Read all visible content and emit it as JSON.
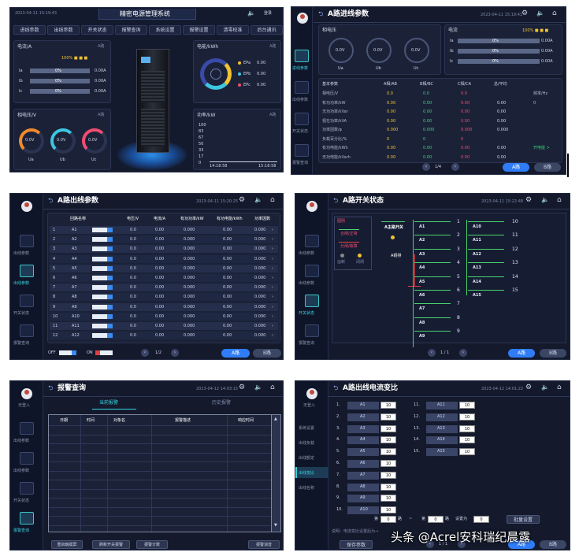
{
  "p1": {
    "time": "2023-04-11 15:19:43",
    "title": "精密电源管理系统",
    "login": "登录",
    "tabs": [
      "进线参数",
      "出线参数",
      "开关状态",
      "报警查询",
      "系统设置",
      "报警设置",
      "清零校准",
      "后台通讯"
    ],
    "current": {
      "title": "电流/A",
      "tag": "A路",
      "legend": "100% ■ ■ ■",
      "rows": [
        {
          "l": "Ia",
          "p": "0%",
          "v": "0.00A"
        },
        {
          "l": "Ib",
          "p": "0%",
          "v": "0.00A"
        },
        {
          "l": "Ic",
          "p": "0%",
          "v": "0.00A"
        }
      ]
    },
    "energy": {
      "title": "电能/kWh",
      "tag": "A路",
      "rows": [
        {
          "l": "EPa",
          "v": "0.00"
        },
        {
          "l": "EPb",
          "v": "0.00"
        },
        {
          "l": "EPc",
          "v": "0.00"
        }
      ]
    },
    "voltage": {
      "title": "相电压/V",
      "tag": "A路",
      "gauges": [
        {
          "v": "0.0V",
          "l": "Ua"
        },
        {
          "v": "0.0V",
          "l": "Ub"
        },
        {
          "v": "0.0V",
          "l": "Uc"
        }
      ]
    },
    "power": {
      "title": "功率/kW",
      "tag": "A路",
      "ticks": [
        "100",
        "83",
        "67",
        "50",
        "33",
        "17",
        "0"
      ],
      "t1": "14:18:58",
      "t2": "15:18:58"
    }
  },
  "p2": {
    "title": "A路进线参数",
    "time": "2023-04-11 15:19:41",
    "nav": [
      "进线参数",
      "出线参数",
      "开关状态",
      "报警查询"
    ],
    "phase_v": {
      "title": "相电压",
      "gauges": [
        {
          "v": "0.0V",
          "l": "Ua"
        },
        {
          "v": "0.0V",
          "l": "Ub"
        },
        {
          "v": "0.0V",
          "l": "Uc"
        }
      ]
    },
    "current": {
      "title": "电流",
      "legend": "100% ■ ■ ■",
      "rows": [
        {
          "l": "Ia",
          "p": "0%",
          "v": "0.00A"
        },
        {
          "l": "Ib",
          "p": "0%",
          "v": "0.00A"
        },
        {
          "l": "Ic",
          "p": "0%",
          "v": "0.00A"
        }
      ]
    },
    "headers": [
      "基本参数",
      "A相/AB",
      "B相/BC",
      "C相/CA",
      "总/平均"
    ],
    "rows": [
      {
        "n": "相电压/V",
        "a": "0.0",
        "b": "0.0",
        "c": "0.0",
        "t": "",
        "x": "频率/Hz"
      },
      {
        "n": "有功功率/kW",
        "a": "0.00",
        "b": "0.00",
        "c": "0.00",
        "t": "0.00",
        "x": "0"
      },
      {
        "n": "无功功率/kVar",
        "a": "0.00",
        "b": "0.00",
        "c": "0.00",
        "t": "0.00",
        "x": ""
      },
      {
        "n": "视在功率/kVA",
        "a": "0.00",
        "b": "0.00",
        "c": "0.00",
        "t": "0.00",
        "x": ""
      },
      {
        "n": "功率因数/φ",
        "a": "0.000",
        "b": "0.000",
        "c": "0.000",
        "t": "0.000",
        "x": ""
      },
      {
        "n": "负载百分比/%",
        "a": "0",
        "b": "0",
        "c": "0",
        "t": "",
        "x": ""
      },
      {
        "n": "有功电能/kWh",
        "a": "0.00",
        "b": "0.00",
        "c": "0.00",
        "t": "0.00",
        "x": "开电能 >"
      },
      {
        "n": "无功电能/kVarh",
        "a": "0.00",
        "b": "0.00",
        "c": "0.00",
        "t": "0.00",
        "x": ""
      }
    ],
    "page": "1/4",
    "btnA": "A路",
    "btnB": "B路"
  },
  "p3": {
    "title": "A路出线参数",
    "time": "2023-04-11 15:20:25",
    "nav": [
      "出线参数",
      "出线参数",
      "开关状态",
      "报警查询"
    ],
    "headers": [
      "回路名称",
      "电压/V",
      "电流/A",
      "有功功率/kW",
      "有功电能/kWh",
      "功率因数"
    ],
    "rows": [
      {
        "i": "1",
        "n": "A1"
      },
      {
        "i": "2",
        "n": "A2"
      },
      {
        "i": "3",
        "n": "A3"
      },
      {
        "i": "4",
        "n": "A4"
      },
      {
        "i": "5",
        "n": "A5"
      },
      {
        "i": "6",
        "n": "A6"
      },
      {
        "i": "7",
        "n": "A7"
      },
      {
        "i": "8",
        "n": "A8"
      },
      {
        "i": "9",
        "n": "A9"
      },
      {
        "i": "10",
        "n": "A10"
      },
      {
        "i": "11",
        "n": "A11"
      },
      {
        "i": "12",
        "n": "A12"
      }
    ],
    "vals": {
      "v": "0.0",
      "a": "0.00",
      "p": "0.000",
      "e": "0.00",
      "pf": "0.000"
    },
    "off": "OFF",
    "on": "ON",
    "page": "1/2",
    "btnA": "A路",
    "btnB": "B路"
  },
  "p4": {
    "title": "A路开关状态",
    "time": "2023-04-11 15:22:48",
    "nav": [
      "出线参数",
      "出线参数",
      "开关状态",
      "报警查询"
    ],
    "legend": [
      "图例",
      "合闸/正常",
      "分闸/故障",
      "运断",
      "闭闸"
    ],
    "main": "A主路开关",
    "bus": "A铜排",
    "left": [
      "A1",
      "A2",
      "A3",
      "A4",
      "A5",
      "A6",
      "A7",
      "A8",
      "A9"
    ],
    "leftnum": [
      "1",
      "2",
      "3",
      "4",
      "5",
      "6",
      "7",
      "8",
      "9"
    ],
    "right": [
      "A10",
      "A11",
      "A12",
      "A13",
      "A14",
      "A15"
    ],
    "rightnum": [
      "10",
      "11",
      "12",
      "13",
      "14",
      "15"
    ],
    "page": "1 / 1",
    "btnA": "A路",
    "btnB": "B路"
  },
  "p5": {
    "title": "报警查询",
    "time": "2023-04-12 14:03:15",
    "user": "无登入",
    "nav": [
      "出线参数",
      "出线参数",
      "开关状态",
      "报警查询"
    ],
    "tabs": [
      "当前报警",
      "历史报警"
    ],
    "headers": [
      "日期",
      "时间",
      "对象名",
      "报警描述",
      "响应时间"
    ],
    "buttons": [
      "重启触摸屏",
      "刷新开关报警",
      "报警计数",
      "报警消音"
    ]
  },
  "p6": {
    "title": "A路出线电流变比",
    "time": "2023-04-12 14:01:22",
    "user": "无登入",
    "nav": [
      "系统设置",
      "出线负载",
      "出线额定",
      "出线变比",
      "出线名称"
    ],
    "left": [
      {
        "i": "1.",
        "n": "A1"
      },
      {
        "i": "2.",
        "n": "A2"
      },
      {
        "i": "3.",
        "n": "A3"
      },
      {
        "i": "4.",
        "n": "A4"
      },
      {
        "i": "5.",
        "n": "A5"
      },
      {
        "i": "6.",
        "n": "A6"
      },
      {
        "i": "7.",
        "n": "A7"
      },
      {
        "i": "8.",
        "n": "A8"
      },
      {
        "i": "9.",
        "n": "A9"
      },
      {
        "i": "10.",
        "n": "A10"
      }
    ],
    "right": [
      {
        "i": "11.",
        "n": "A11"
      },
      {
        "i": "12.",
        "n": "A12"
      },
      {
        "i": "13.",
        "n": "A13"
      },
      {
        "i": "14.",
        "n": "A14"
      },
      {
        "i": "15.",
        "n": "A15"
      }
    ],
    "val": "10",
    "batch": {
      "di": "第",
      "lu": "路",
      "to": "~",
      "di2": "第",
      "lu2": "路",
      "set": "设置为",
      "a": "0",
      "b": "0",
      "c": "0",
      "btn": "批量设置"
    },
    "hint": "说明：电流变比设置后为→",
    "save": "保存参数",
    "page": "1 / 1",
    "btnA": "A路",
    "btnB": "B路"
  },
  "watermark": "头条 @Acrel安科瑞纪晨露"
}
